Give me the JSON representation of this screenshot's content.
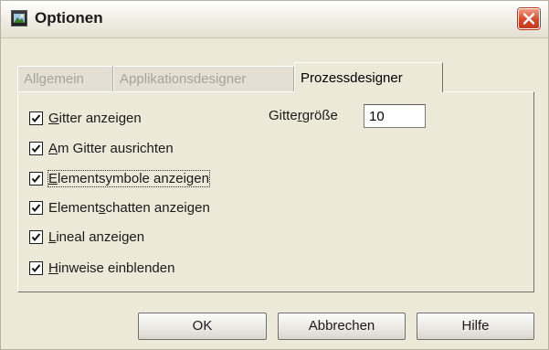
{
  "window": {
    "title": "Optionen"
  },
  "tabs": [
    {
      "label": "Allgemein",
      "active": false
    },
    {
      "label": "Applikationsdesigner",
      "active": false
    },
    {
      "label": "Prozessdesigner",
      "active": true
    }
  ],
  "options": [
    {
      "label_mnemonic": "G",
      "label_rest": "itter anzeigen",
      "checked": true
    },
    {
      "label_mnemonic": "A",
      "label_rest": "m Gitter ausrichten",
      "checked": true
    },
    {
      "label_mnemonic": "E",
      "label_rest": "lementsymbole anzeigen",
      "checked": true
    },
    {
      "label_pre": "Element",
      "label_mnemonic": "s",
      "label_rest": "chatten anzeigen",
      "checked": true
    },
    {
      "label_mnemonic": "L",
      "label_rest": "ineal anzeigen",
      "checked": true
    },
    {
      "label_mnemonic": "H",
      "label_rest": "inweise einblenden",
      "checked": true
    }
  ],
  "grid_size": {
    "label_pre": "Gitte",
    "label_mnemonic": "r",
    "label_rest": "größe",
    "value": "10"
  },
  "buttons": {
    "ok": "OK",
    "cancel": "Abbrechen",
    "help": "Hilfe"
  }
}
